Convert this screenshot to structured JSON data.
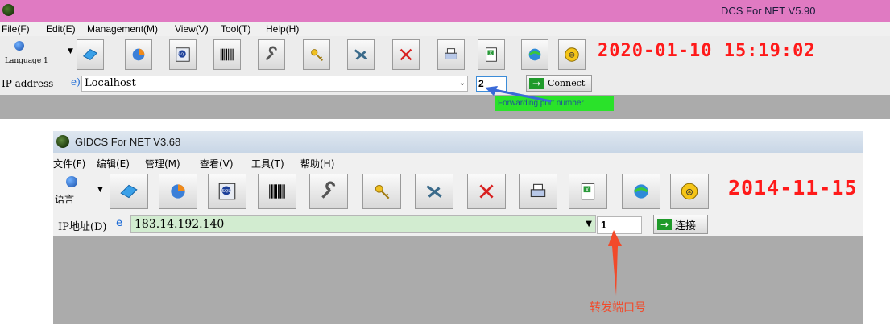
{
  "window1": {
    "title": "DCS For NET V5.90",
    "menu": [
      "File(F)",
      "Edit(E)",
      "Management(M)",
      "View(V)",
      "Tool(T)",
      "Help(H)"
    ],
    "language_label": "Language 1",
    "clock": "2020-01-10  15:19:02",
    "ip_label": "IP address",
    "ip_value": "Localhost",
    "port_value": "2",
    "connect_label": "Connect",
    "tooltip": "Forwarding port number",
    "colors": {
      "titlebar": "#e07ac2",
      "clock": "#ff1a1a",
      "tooltip_bg": "#2ae22a",
      "arrow": "#3a6ad8"
    }
  },
  "window2": {
    "title": "GIDCS For NET V3.68",
    "menu": [
      "文件(F)",
      "编辑(E)",
      "管理(M)",
      "查看(V)",
      "工具(T)",
      "帮助(H)"
    ],
    "language_label": "语言一",
    "clock": "2014-11-15",
    "ip_label": "IP地址(D)",
    "ip_value": "183.14.192.140",
    "port_value": "1",
    "connect_label": "连接",
    "annotation": "转发端口号",
    "colors": {
      "clock": "#ff1a1a",
      "ip_bg": "#d2ecd0",
      "annotation": "#f24a2a"
    }
  },
  "toolbar_icons": [
    "language-globe-icon",
    "book-icon",
    "pie-icon",
    "sql-icon",
    "barcode-icon",
    "wrench-icon",
    "key-icon",
    "tools-icon",
    "delete-icon",
    "printer-icon",
    "excel-icon",
    "globe-icon",
    "exit-icon"
  ]
}
